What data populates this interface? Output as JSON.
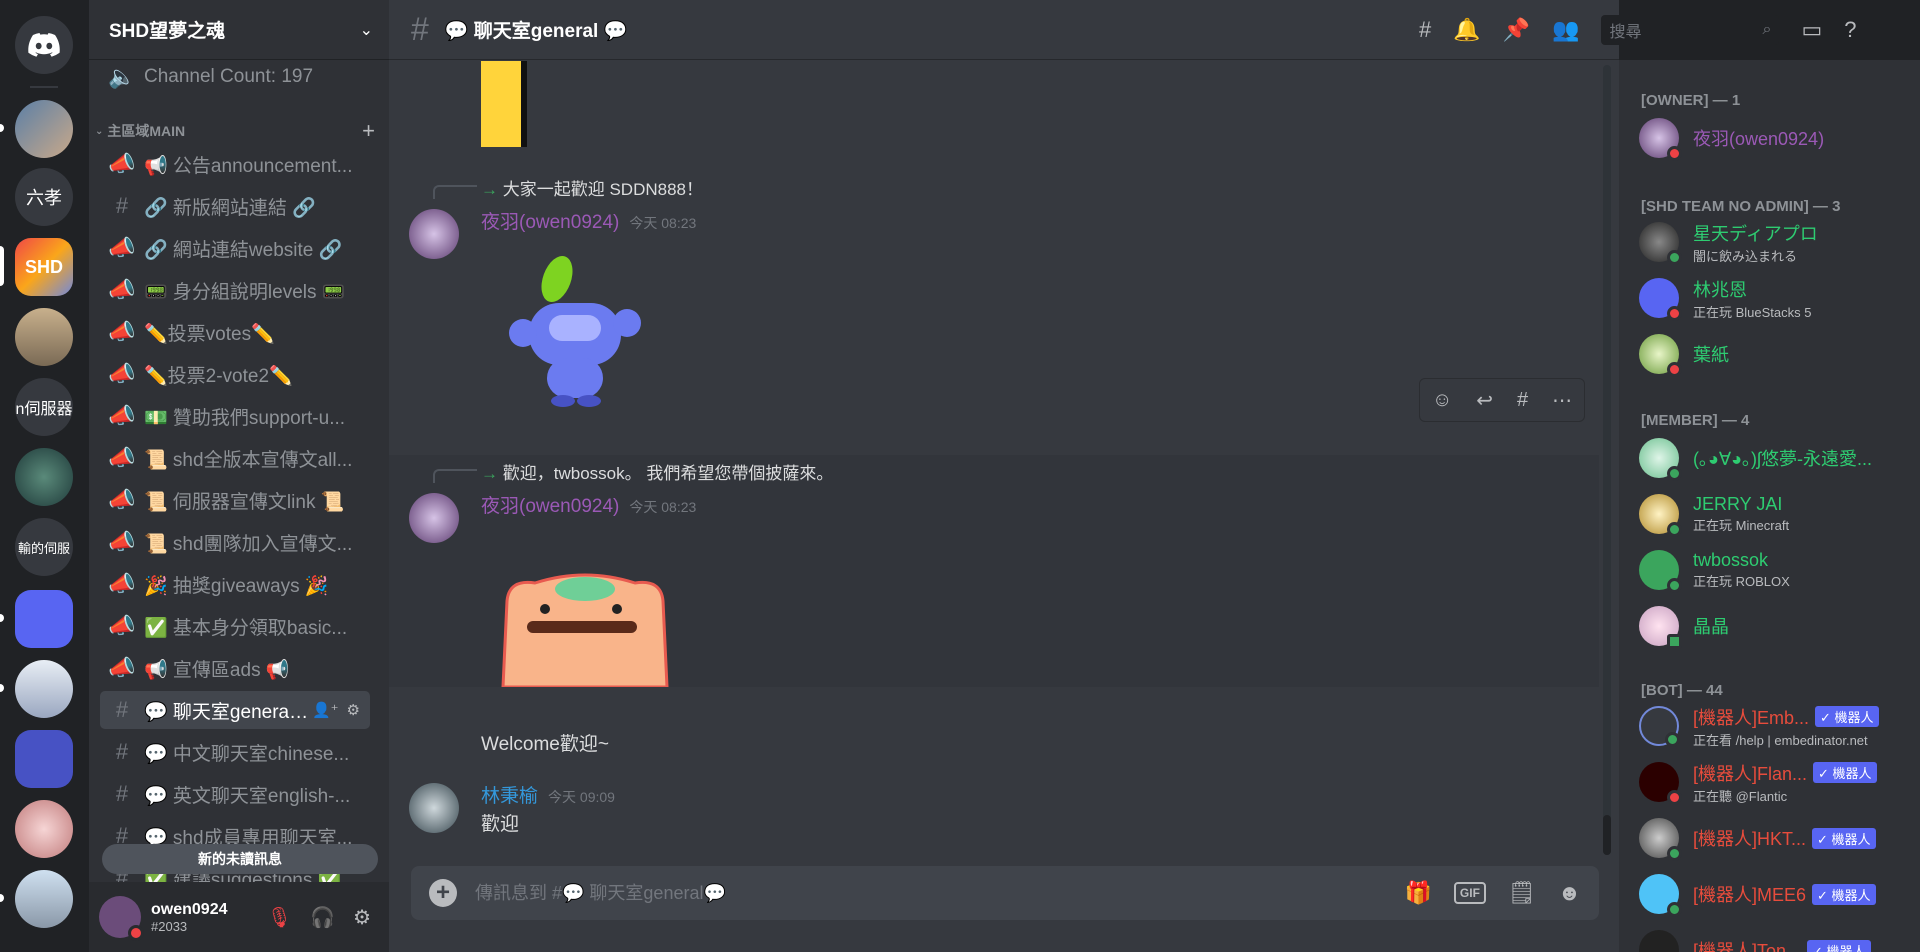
{
  "guild": {
    "name": "SHD望夢之魂",
    "channel_count": "Channel Count: 197"
  },
  "rail": {
    "labels": [
      "六孝",
      "n伺服器",
      "輸的伺服"
    ]
  },
  "category": {
    "name": "主區域MAIN"
  },
  "channels": [
    {
      "label": "📢 公告announcement...",
      "icon": "announcement-icon"
    },
    {
      "label": "🔗 新版網站連結 🔗",
      "icon": "hash-icon"
    },
    {
      "label": "🔗 網站連結website 🔗",
      "icon": "announcement-icon"
    },
    {
      "label": "📟 身分組說明levels 📟",
      "icon": "announcement-icon"
    },
    {
      "label": "✏️投票votes✏️",
      "icon": "announcement-icon"
    },
    {
      "label": "✏️投票2-vote2✏️",
      "icon": "announcement-icon"
    },
    {
      "label": "💵 贊助我們support-u...",
      "icon": "announcement-icon"
    },
    {
      "label": "📜 shd全版本宣傳文all...",
      "icon": "announcement-icon"
    },
    {
      "label": "📜 伺服器宣傳文link 📜",
      "icon": "announcement-icon"
    },
    {
      "label": "📜 shd團隊加入宣傳文...",
      "icon": "announcement-icon"
    },
    {
      "label": "🎉 抽獎giveaways 🎉",
      "icon": "announcement-icon"
    },
    {
      "label": "✅ 基本身分領取basic...",
      "icon": "announcement-icon"
    },
    {
      "label": "📢 宣傳區ads 📢",
      "icon": "announcement-icon"
    },
    {
      "label": "💬 聊天室general 💬",
      "icon": "hash-icon"
    },
    {
      "label": "💬 中文聊天室chinese...",
      "icon": "hash-icon"
    },
    {
      "label": "💬 英文聊天室english-...",
      "icon": "hash-icon"
    },
    {
      "label": "💬 shd成員專用聊天室...",
      "icon": "hash-icon"
    },
    {
      "label": "✅ 建議suggestions ✅",
      "icon": "hash-icon"
    }
  ],
  "unread_pill": "新的未讀訊息",
  "user": {
    "name": "owen0924",
    "tag": "#2033"
  },
  "chat": {
    "channel_title": "💬 聊天室general 💬",
    "search_placeholder": "搜尋",
    "messages": [
      {
        "reply": "大家一起歡迎 SDDN888！",
        "author": "夜羽(owen0924)",
        "time": "今天 08:23"
      },
      {
        "reply": "歡迎，twbossok。 我們希望您帶個披薩來。",
        "author": "夜羽(owen0924)",
        "time": "今天 08:23"
      },
      {
        "text": "Welcome歡迎~"
      },
      {
        "author": "林秉榆",
        "time": "今天 09:09",
        "text": "歡迎"
      }
    ],
    "composer_placeholder": "傳訊息到 #💬 聊天室general💬",
    "gif_label": "GIF"
  },
  "members": {
    "groups": [
      {
        "title": "[OWNER] — 1"
      },
      {
        "title": "[SHD TEAM NO ADMIN] — 3"
      },
      {
        "title": "[MEMBER] — 4"
      },
      {
        "title": "[BOT] — 44"
      }
    ],
    "list": [
      {
        "name": "夜羽(owen0924)",
        "sub": ""
      },
      {
        "name": "星天ディアプロ",
        "sub": "闇に飲み込まれる"
      },
      {
        "name": "林兆恩",
        "sub": "正在玩 BlueStacks 5"
      },
      {
        "name": "葉紙",
        "sub": ""
      },
      {
        "name": "(｡◕∀◕｡)ʃ悠夢-永遠愛...",
        "sub": ""
      },
      {
        "name": "JERRY JAI",
        "sub": "正在玩 Minecraft"
      },
      {
        "name": "twbossok",
        "sub": "正在玩 ROBLOX"
      },
      {
        "name": "晶晶",
        "sub": ""
      },
      {
        "name": "[機器人]Emb...",
        "sub": "正在看 /help | embedinator.net",
        "badge": "✓ 機器人"
      },
      {
        "name": "[機器人]Flan...",
        "sub": "正在聽 @Flantic",
        "badge": "✓ 機器人"
      },
      {
        "name": "[機器人]HKT...",
        "sub": "",
        "badge": "✓ 機器人"
      },
      {
        "name": "[機器人]MEE6",
        "sub": "",
        "badge": "✓ 機器人"
      },
      {
        "name": "[機器人]Ton...",
        "sub": "",
        "badge": "✓ 機器人"
      }
    ]
  },
  "colors": {
    "owner": "#9b59b6",
    "team": "#2ecc71",
    "member": "#2ecc71",
    "bot": "#e74c3c",
    "author2": "#3498db",
    "dnd": "#ed4245",
    "online": "#3ba55d"
  }
}
